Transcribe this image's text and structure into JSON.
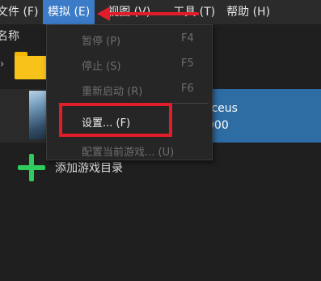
{
  "menubar": {
    "items": [
      {
        "label": "文件 (F)"
      },
      {
        "label": "模拟 (E)"
      },
      {
        "label": "视图 (V)"
      },
      {
        "label": "工具 (T)"
      },
      {
        "label": "帮助 (H)"
      }
    ]
  },
  "list_header": {
    "name_col": "名称"
  },
  "game": {
    "title": "rceus",
    "subtitle": "000"
  },
  "add_dir": {
    "label": "添加游戏目录"
  },
  "emulation_menu": {
    "items": [
      {
        "label": "暂停 (P)",
        "shortcut": "F4"
      },
      {
        "label": "停止 (S)",
        "shortcut": "F5"
      },
      {
        "label": "重新启动 (R)",
        "shortcut": "F6"
      },
      {
        "label": "设置... (F)",
        "shortcut": ""
      },
      {
        "label": "配置当前游戏... (U)",
        "shortcut": ""
      }
    ]
  },
  "colors": {
    "menu_active": "#3b7bc7",
    "highlight": "#e11d2a",
    "selection": "#2e6da4",
    "folder": "#f7c31a",
    "add_plus": "#2ecc5a"
  }
}
